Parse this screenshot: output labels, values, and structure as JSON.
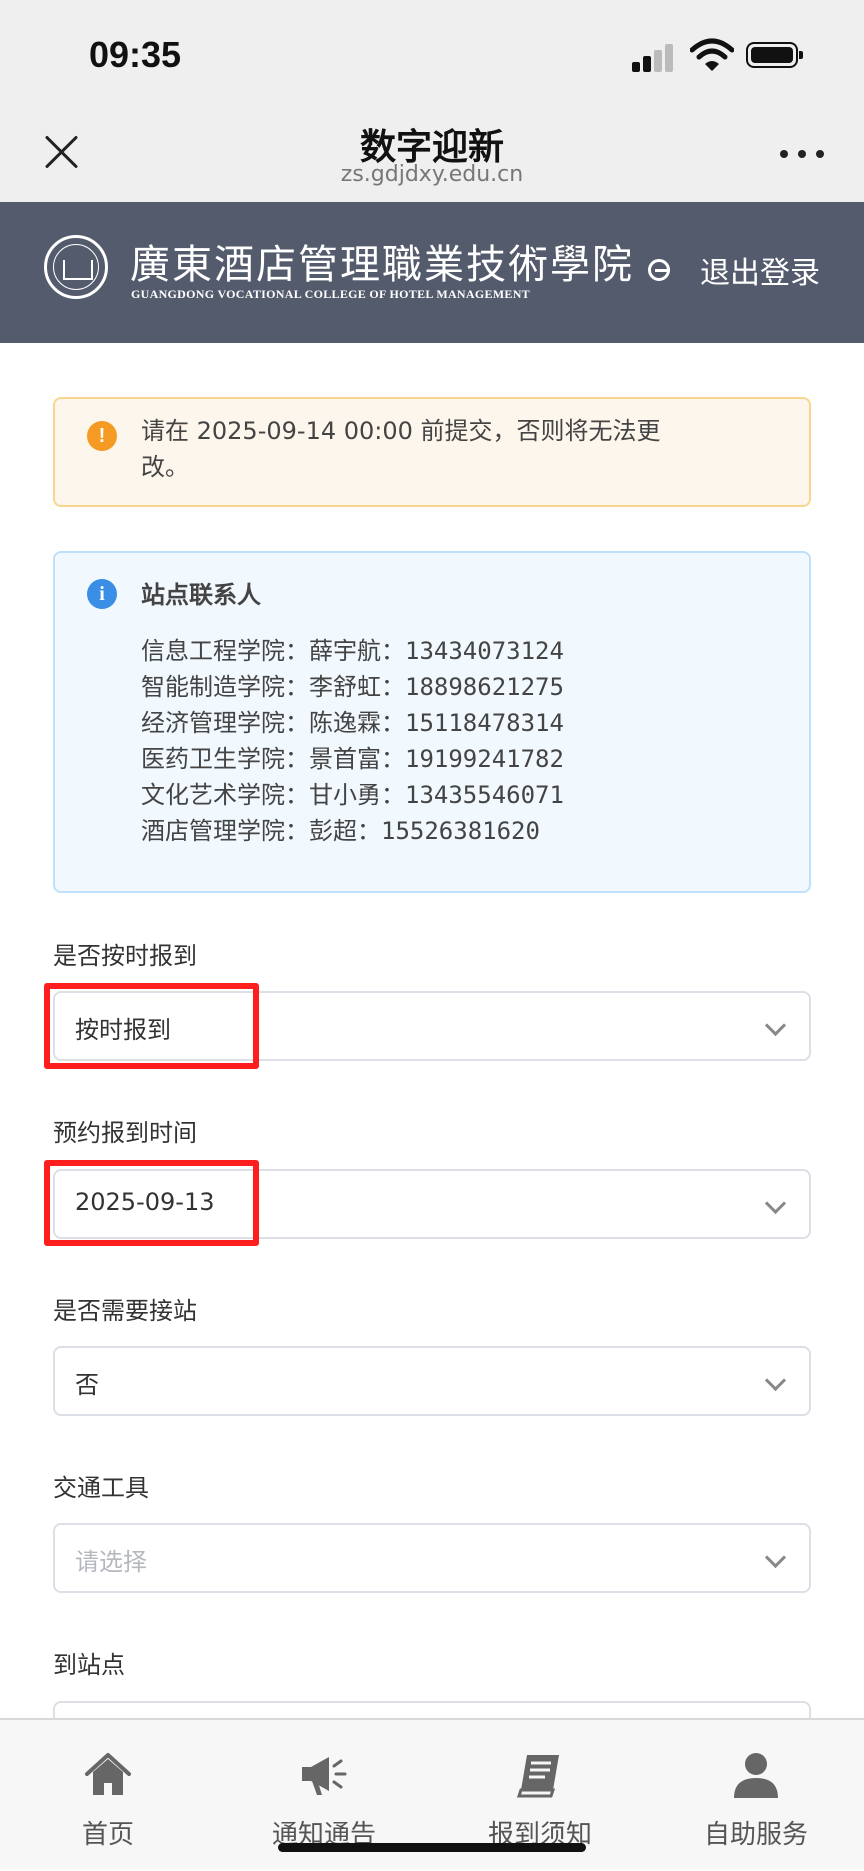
{
  "status_bar": {
    "time": "09:35"
  },
  "wechat_header": {
    "title": "数字迎新",
    "url": "zs.gdjdxy.edu.cn"
  },
  "banner": {
    "college_name": "廣東酒店管理職業技術學院",
    "college_name_en": "GUANGDONG VOCATIONAL COLLEGE OF HOTEL MANAGEMENT",
    "logout_label": "退出登录"
  },
  "notice": {
    "text": "请在 2025-09-14 00:00 前提交，否则将无法更改。"
  },
  "contact_box": {
    "title": "站点联系人",
    "contacts": [
      "信息工程学院：薛宇航：13434073124",
      "智能制造学院：李舒虹：18898621275",
      "经济管理学院：陈逸霖：15118478314",
      "医药卫生学院：景首富：19199241782",
      "文化艺术学院：甘小勇：13435546071",
      "酒店管理学院：彭超：15526381620"
    ]
  },
  "form": {
    "on_time": {
      "label": "是否按时报到",
      "value": "按时报到"
    },
    "arrival_date": {
      "label": "预约报到时间",
      "value": "2025-09-13"
    },
    "pickup": {
      "label": "是否需要接站",
      "value": "否"
    },
    "transport": {
      "label": "交通工具",
      "placeholder": "请选择"
    },
    "station": {
      "label": "到站点"
    }
  },
  "tabbar": {
    "items": [
      {
        "label": "首页",
        "icon": "home-icon"
      },
      {
        "label": "通知通告",
        "icon": "megaphone-icon"
      },
      {
        "label": "报到须知",
        "icon": "book-icon"
      },
      {
        "label": "自助服务",
        "icon": "user-icon"
      }
    ]
  },
  "colors": {
    "banner_bg": "#545b6d",
    "warning": "#f59a23",
    "info": "#3a8ee6",
    "highlight": "#ff1e1e"
  }
}
